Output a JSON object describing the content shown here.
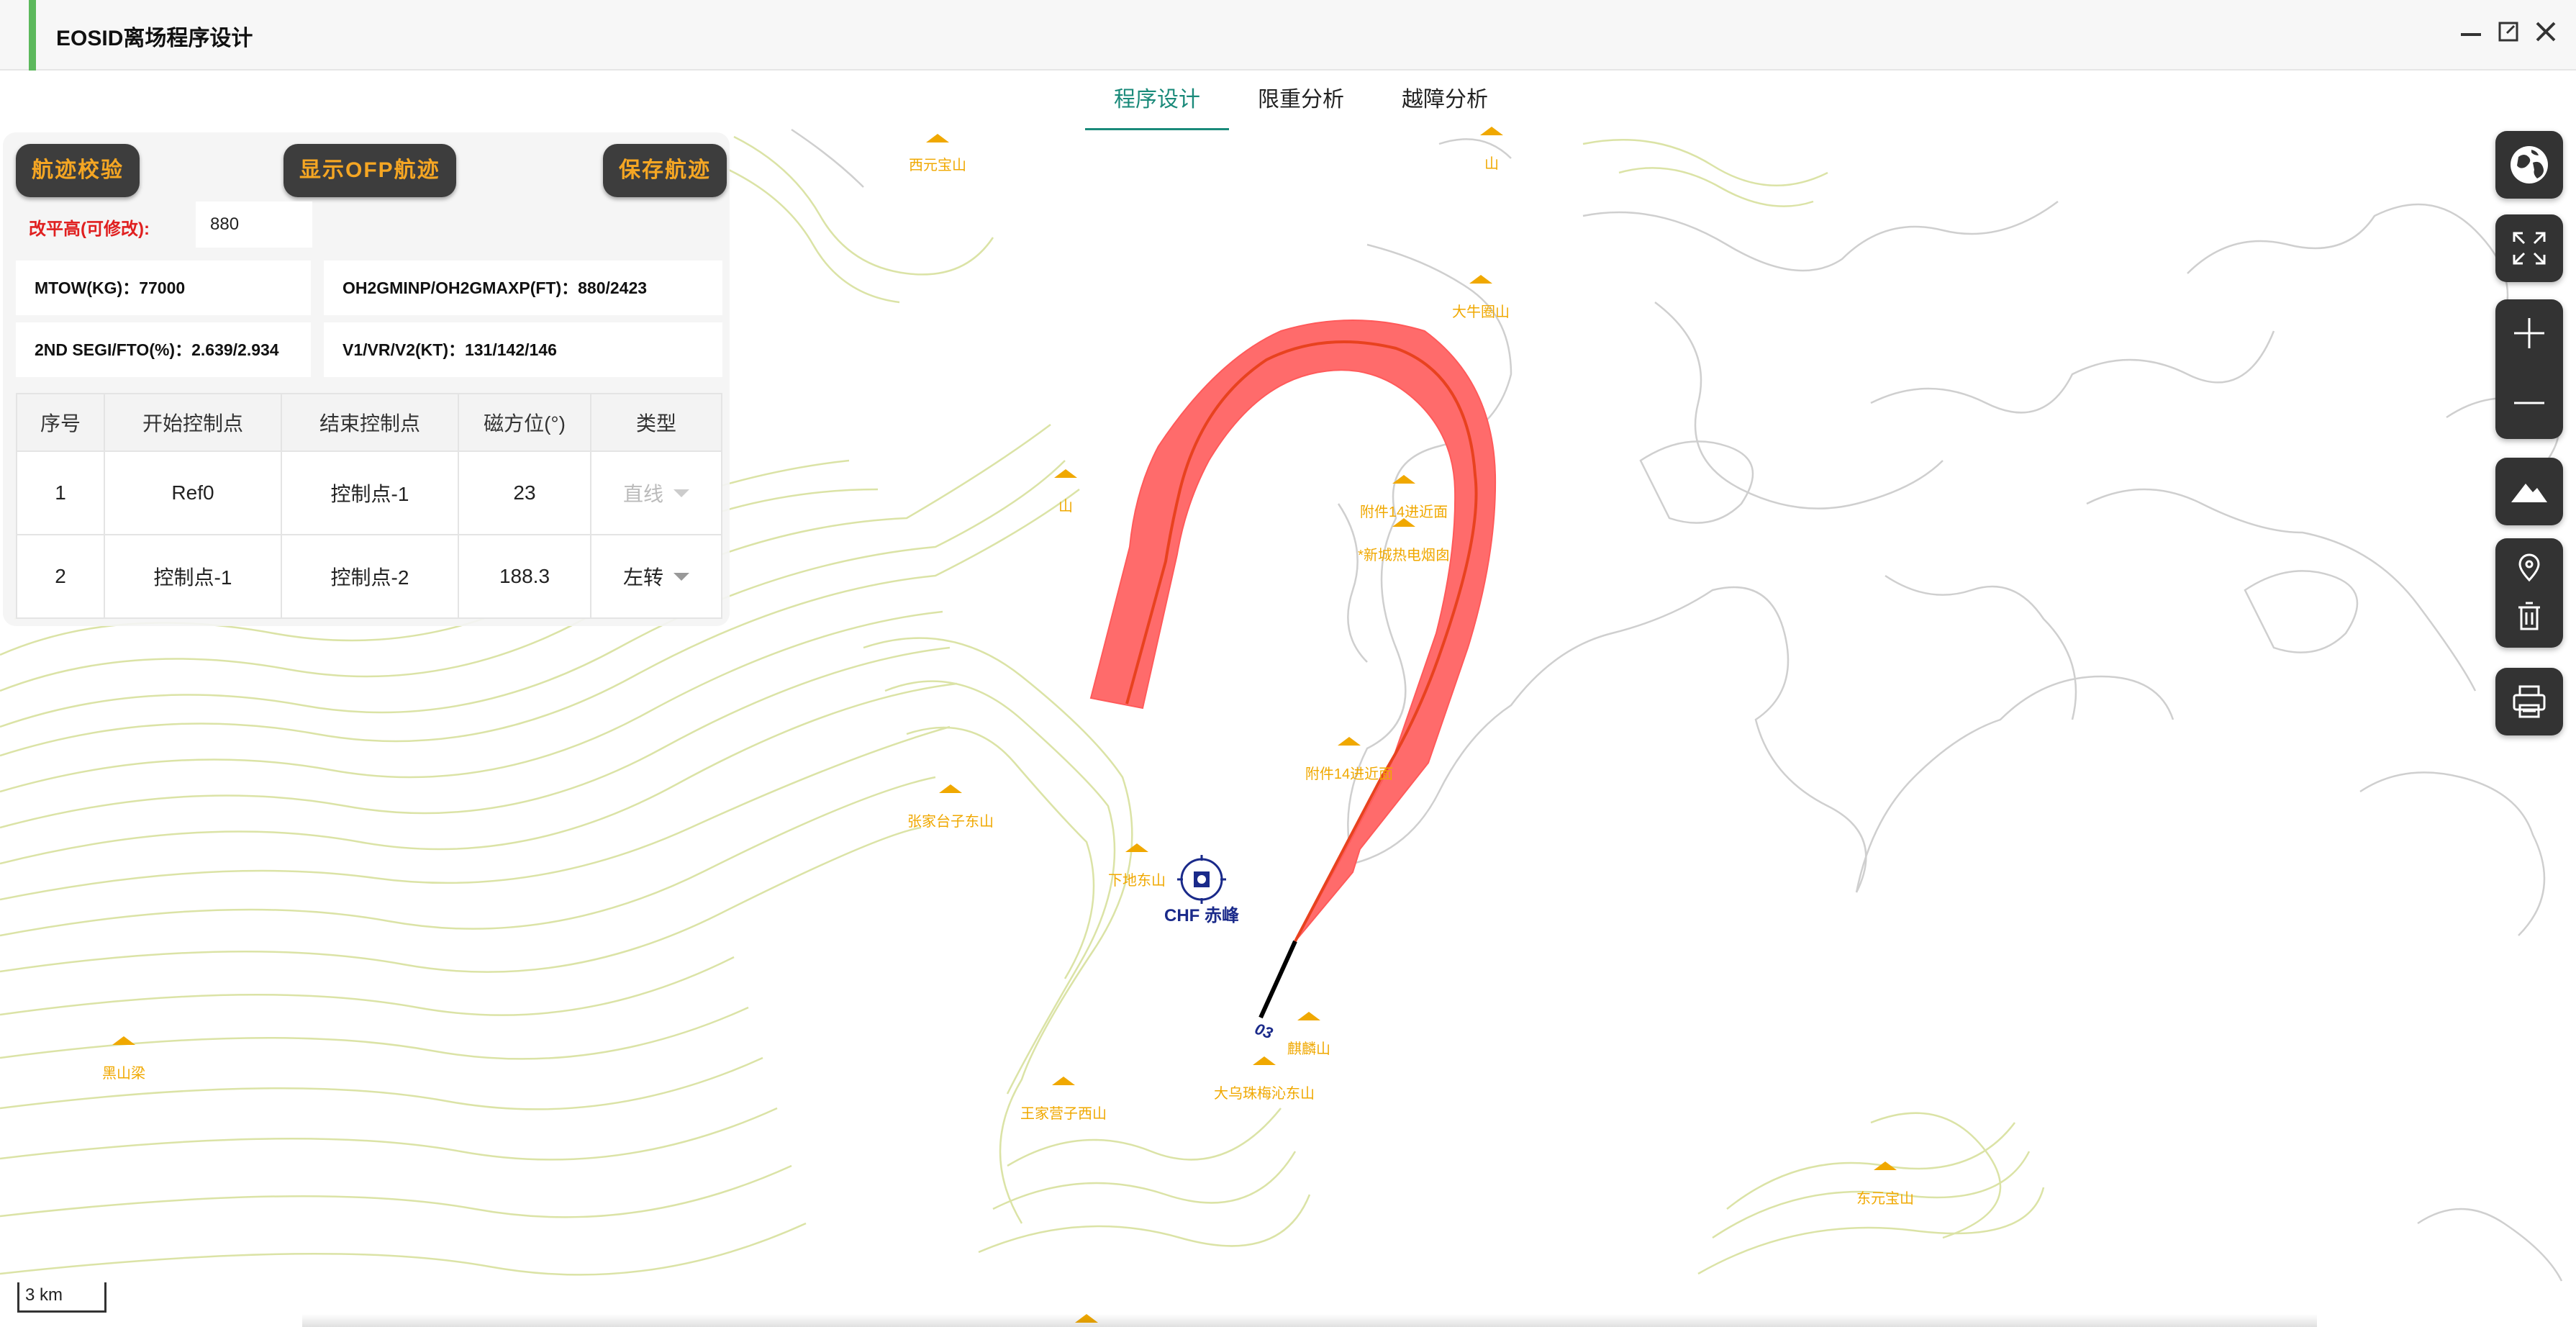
{
  "window": {
    "title": "EOSID离场程序设计"
  },
  "tabs": [
    {
      "label": "程序设计",
      "active": true
    },
    {
      "label": "限重分析",
      "active": false
    },
    {
      "label": "越障分析",
      "active": false
    }
  ],
  "panel": {
    "buttons": {
      "verify": "航迹校验",
      "show_ofp": "显示OFP航迹",
      "save": "保存航迹"
    },
    "elevation": {
      "label": "改平高(可修改):",
      "value": "880"
    },
    "info": {
      "mtow": "MTOW(KG)：77000",
      "oh2g": "OH2GMINP/OH2GMAXP(FT)：880/2423",
      "seg": "2ND SEGI/FTO(%)：2.639/2.934",
      "vspeeds": "V1/VR/V2(KT)：131/142/146"
    },
    "table": {
      "headers": [
        "序号",
        "开始控制点",
        "结束控制点",
        "磁方位(°)",
        "类型"
      ],
      "rows": [
        {
          "no": "1",
          "start": "Ref0",
          "end": "控制点-1",
          "bearing": "23",
          "type": "直线"
        },
        {
          "no": "2",
          "start": "控制点-1",
          "end": "控制点-2",
          "bearing": "188.3",
          "type": "左转"
        }
      ]
    }
  },
  "map": {
    "station": "CHF 赤峰",
    "runway": "03",
    "scale": "3 km",
    "peaks": [
      "西元宝山",
      "山",
      "大牛圈山",
      "山",
      "附件14进近面",
      "*新城热电烟囱",
      "附件14进近面",
      "张家台子东山",
      "下地东山",
      "麒麟山",
      "大乌珠梅沁东山",
      "王家营子西山",
      "黑山梁",
      "东元宝山"
    ],
    "colors": {
      "track": "#ff6b6b",
      "centerline": "#e8421f",
      "peak": "#f0a800",
      "station": "#1a2a8a"
    }
  },
  "toolbar": {
    "icons": [
      "globe-icon",
      "fullscreen-icon",
      "zoom-in-icon",
      "zoom-out-icon",
      "terrain-icon",
      "location-pin-icon",
      "trash-icon",
      "printer-icon"
    ]
  }
}
